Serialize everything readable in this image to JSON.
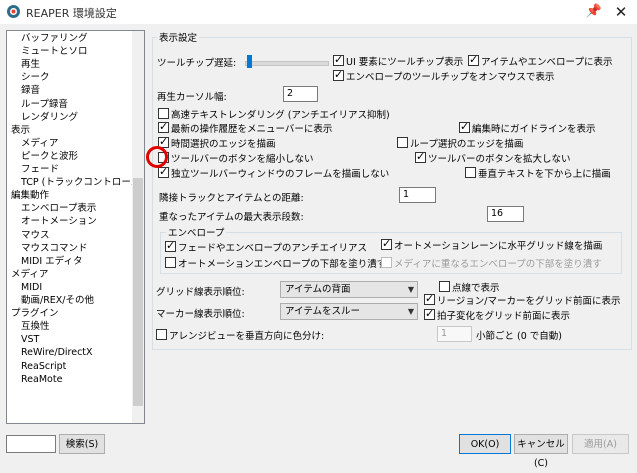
{
  "window": {
    "title": "REAPER 環境設定",
    "pin_icon": "pin-icon",
    "close_label": "✕"
  },
  "tree": {
    "items": [
      {
        "label": "バッファリング",
        "indent": 1
      },
      {
        "label": "ミュートとソロ",
        "indent": 1
      },
      {
        "label": "再生",
        "indent": 1
      },
      {
        "label": "シーク",
        "indent": 1
      },
      {
        "label": "録音",
        "indent": 1
      },
      {
        "label": "ループ録音",
        "indent": 1
      },
      {
        "label": "レンダリング",
        "indent": 1
      },
      {
        "label": "表示",
        "indent": 0
      },
      {
        "label": "メディア",
        "indent": 1
      },
      {
        "label": "ピークと波形",
        "indent": 1
      },
      {
        "label": "フェード",
        "indent": 1
      },
      {
        "label": "TCP (トラックコントロール)",
        "indent": 1
      },
      {
        "label": "編集動作",
        "indent": 0
      },
      {
        "label": "エンベロープ表示",
        "indent": 1
      },
      {
        "label": "オートメーション",
        "indent": 1
      },
      {
        "label": "マウス",
        "indent": 1
      },
      {
        "label": "マウスコマンド",
        "indent": 1
      },
      {
        "label": "MIDI エディタ",
        "indent": 1
      },
      {
        "label": "メディア",
        "indent": 0
      },
      {
        "label": "MIDI",
        "indent": 1
      },
      {
        "label": "動画/REX/その他",
        "indent": 1
      },
      {
        "label": "プラグイン",
        "indent": 0
      },
      {
        "label": "互換性",
        "indent": 1
      },
      {
        "label": "VST",
        "indent": 1
      },
      {
        "label": "ReWire/DirectX",
        "indent": 1
      },
      {
        "label": "ReaScript",
        "indent": 1
      },
      {
        "label": "ReaMote",
        "indent": 1
      }
    ]
  },
  "panel": {
    "group_title": "表示設定",
    "tooltip_delay_label": "ツールチップ遅延:",
    "tooltip_delay_value": 0.02,
    "cb_ui_tooltip": "UI 要素にツールチップ表示",
    "cb_item_env_tooltip": "アイテムやエンベロープに表示",
    "cb_env_tooltip_mouseover": "エンベロープのツールチップをオンマウスで表示",
    "cursor_width_label": "再生カーソル幅:",
    "cursor_width_value": "2",
    "cb_hq_text": "高速テキストレンダリング (アンチエイリアス抑制)",
    "cb_recent_undo": "最新の操作履歴をメニューバーに表示",
    "cb_edit_guides": "編集時にガイドラインを表示",
    "cb_time_sel_edges": "時間選択のエッジを描画",
    "cb_loop_sel_edges": "ループ選択のエッジを描画",
    "cb_shrink_toolbar": "ツールバーのボタンを縮小しない",
    "cb_enlarge_toolbar": "ツールバーのボタンを拡大しない",
    "cb_no_toolbar_frame": "独立ツールバーウィンドウのフレームを描画しない",
    "cb_vertical_text": "垂直テキストを下から上に描画",
    "adjacent_gap_label": "隣接トラックとアイテムとの距離:",
    "adjacent_gap_value": "1",
    "max_overlap_label": "重なったアイテムの最大表示段数:",
    "max_overlap_value": "16",
    "envelope_group_title": "エンベロープ",
    "cb_env_antialias": "フェードやエンベロープのアンチエイリアス",
    "cb_automation_gridlines": "オートメーションレーンに水平グリッド線を描画",
    "cb_fill_automation": "オートメーションエンベロープの下部を塗り潰す",
    "cb_fill_media_env": "メディアに重なるエンベロープの下部を塗り潰す",
    "grid_order_label": "グリッド線表示順位:",
    "grid_order_value": "アイテムの背面",
    "marker_order_label": "マーカー線表示順位:",
    "marker_order_value": "アイテムをスルー",
    "cb_dotted": "点線で表示",
    "cb_region_marker_front": "リージョン/マーカーをグリッド前面に表示",
    "cb_time_sig_front": "拍子変化をグリッド前面に表示",
    "cb_arrange_vertical": "アレンジビューを垂直方向に色分け:",
    "measures_value": "1",
    "measures_suffix": "小節ごと (0 で自動)"
  },
  "footer": {
    "search_placeholder": "",
    "search_label": "検索(S)",
    "ok_label": "OK(O)",
    "cancel_label": "キャンセル(C)",
    "apply_label": "適用(A)"
  },
  "colors": {
    "accent": "#0078d7",
    "highlight_circle": "#e00000"
  }
}
